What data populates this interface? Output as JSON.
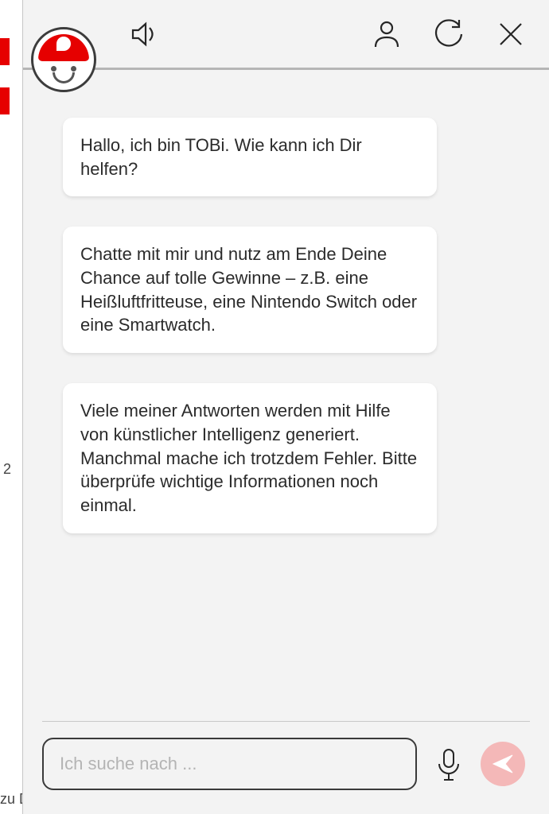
{
  "header": {
    "avatar_name": "TOBi",
    "sound_icon": "sound-icon",
    "profile_icon": "person-icon",
    "reset_icon": "refresh-icon",
    "close_icon": "close-icon"
  },
  "messages": [
    {
      "text": "Hallo, ich bin TOBi. Wie kann ich Dir helfen?"
    },
    {
      "text": "Chatte mit mir und nutz am Ende Deine Chance auf tolle Gewinne – z.B. eine Heißluftfritteuse, eine Nintendo Switch oder eine Smartwatch."
    },
    {
      "text": "Viele meiner Antworten werden mit Hilfe von künstlicher Intelligenz generiert. Manchmal mache ich trotzdem Fehler. Bitte überprüfe wichtige Informationen noch einmal."
    }
  ],
  "input": {
    "placeholder": "Ich suche nach ...",
    "value": ""
  },
  "colors": {
    "brand_red": "#e60000",
    "send_disabled": "#f4b8b8"
  }
}
